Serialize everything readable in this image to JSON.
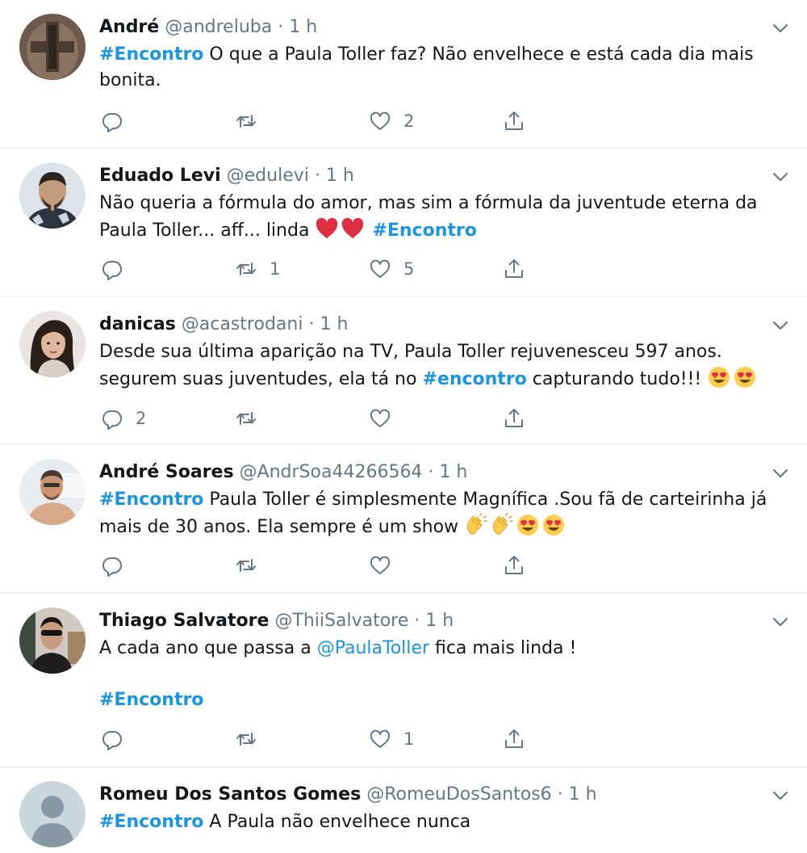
{
  "tweets": [
    {
      "name": "André",
      "handle": "@andreluba",
      "time": "1 h",
      "tag": "#Encontro",
      "text": " O que a Paula Toller faz? Não envelhece e está cada dia mais bonita.",
      "counts": {
        "reply": "",
        "retweet": "",
        "like": "2"
      }
    },
    {
      "name": "Eduado Levi",
      "handle": "@edulevi",
      "time": "1 h",
      "text": "Não queria a fórmula do amor, mas sim a fórmula da juventude eterna da Paula Toller... aff... linda ",
      "tag": "#Encontro",
      "emoji": [
        "red-heart-icon",
        "red-heart-icon"
      ],
      "counts": {
        "reply": "",
        "retweet": "1",
        "like": "5"
      }
    },
    {
      "name": "danicas",
      "handle": "@acastrodani",
      "time": "1 h",
      "text": "Desde sua última aparição na TV, Paula Toller rejuvenesceu 597 anos. segurem suas juventudes, ela tá no ",
      "tag": "#encontro",
      "text2": " capturando tudo!!! ",
      "emoji": [
        "heart-eyes-icon",
        "heart-eyes-icon"
      ],
      "counts": {
        "reply": "2",
        "retweet": "",
        "like": ""
      }
    },
    {
      "name": "André Soares",
      "handle": "@AndrSoa44266564",
      "time": "1 h",
      "tag": "#Encontro",
      "text": " Paula Toller é simplesmente Magnífica .Sou fã de carteirinha já mais de 30 anos. Ela sempre é um show ",
      "emoji": [
        "clapping-hands-icon",
        "clapping-hands-icon",
        "heart-eyes-icon",
        "heart-eyes-icon"
      ],
      "counts": {
        "reply": "",
        "retweet": "",
        "like": ""
      }
    },
    {
      "name": "Thiago Salvatore",
      "handle": "@ThiiSalvatore",
      "time": "1 h",
      "text": "A cada ano que passa a ",
      "mention": "@PaulaToller",
      "text2": " fica mais linda !",
      "tag": "#Encontro",
      "counts": {
        "reply": "",
        "retweet": "",
        "like": "1"
      }
    },
    {
      "name": "Romeu Dos Santos Gomes",
      "handle": "@RomeuDosSantos6",
      "time": "1 h",
      "tag": "#Encontro",
      "text": " A Paula não envelhece nunca"
    }
  ],
  "separator": "·",
  "icons": {
    "reply": "reply-icon",
    "retweet": "retweet-icon",
    "like": "heart-outline-icon",
    "share": "share-icon",
    "caret": "chevron-down-icon"
  },
  "colors": {
    "link": "#1b95e0",
    "secondary_text": "#657786",
    "divider": "#e6ecf0"
  }
}
